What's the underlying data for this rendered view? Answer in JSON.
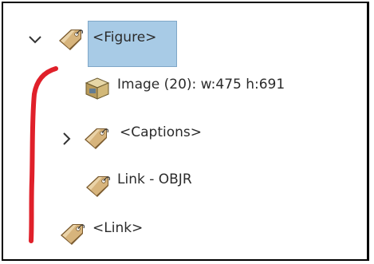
{
  "tree": {
    "nodes": [
      {
        "label": "<Figure>",
        "icon": "tag-icon",
        "expanded": true,
        "selected": true
      },
      {
        "label": "Image (20): w:475 h:691",
        "icon": "image-box-icon"
      },
      {
        "label": "<Captions>",
        "icon": "tag-icon",
        "expanded": false
      },
      {
        "label": "Link - OBJR",
        "icon": "tag-icon"
      },
      {
        "label": "<Link>",
        "icon": "tag-icon"
      }
    ]
  },
  "colors": {
    "selection": "#a8cbe6",
    "tag": "#c9a36b",
    "annotation": "#e0202a"
  }
}
